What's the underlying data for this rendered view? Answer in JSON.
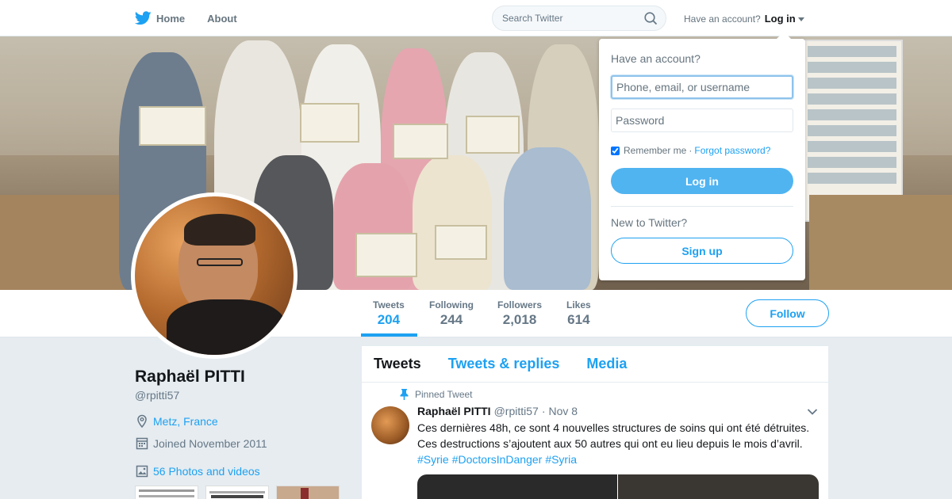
{
  "nav": {
    "home_label": "Home",
    "about_label": "About",
    "search_placeholder": "Search Twitter",
    "have_account": "Have an account?",
    "login_label": "Log in"
  },
  "profile": {
    "name": "Raphaël PITTI",
    "handle": "@rpitti57",
    "location": "Metz, France",
    "joined": "Joined November 2011",
    "photos_videos": "56 Photos and videos",
    "follow_label": "Follow"
  },
  "stats": [
    {
      "label": "Tweets",
      "value": "204"
    },
    {
      "label": "Following",
      "value": "244"
    },
    {
      "label": "Followers",
      "value": "2,018"
    },
    {
      "label": "Likes",
      "value": "614"
    }
  ],
  "timeline": {
    "tabs": [
      "Tweets",
      "Tweets & replies",
      "Media"
    ],
    "pinned_label": "Pinned Tweet",
    "tweet": {
      "name": "Raphaël PITTI",
      "handle": "@rpitti57",
      "separator": "·",
      "date": "Nov 8",
      "text": "Ces dernières 48h, ce sont 4 nouvelles structures de soins qui ont été détruites. Ces destructions s’ajoutent aux 50 autres qui ont eu lieu depuis le mois d’avril.",
      "hashtags": [
        "#Syrie",
        "#DoctorsInDanger",
        "#Syria"
      ]
    }
  },
  "login_dropdown": {
    "title": "Have an account?",
    "username_placeholder": "Phone, email, or username",
    "password_placeholder": "Password",
    "remember_label": "Remember me",
    "separator": "·",
    "forgot_label": "Forgot password?",
    "login_button": "Log in",
    "new_label": "New to Twitter?",
    "signup_button": "Sign up"
  },
  "colors": {
    "accent": "#1da1f2",
    "text_secondary": "#657786",
    "background": "#e6ecf0"
  }
}
